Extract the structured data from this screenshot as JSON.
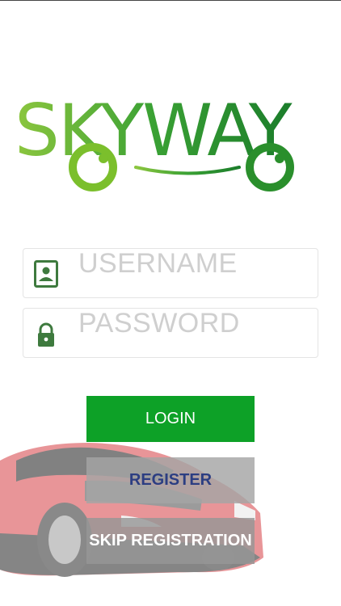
{
  "app": {
    "logo_text": "SKYWAY",
    "colors": {
      "light_green": "#8cc63f",
      "dark_green": "#1b7d2b",
      "mid_green": "#2e9a31"
    }
  },
  "form": {
    "username": {
      "placeholder": "USERNAME",
      "icon": "contact-card-icon"
    },
    "password": {
      "placeholder": "PASSWORD",
      "icon": "lock-icon"
    }
  },
  "buttons": {
    "login": "LOGIN",
    "register": "REGISTER",
    "skip": "SKIP REGISTRATION"
  },
  "colors": {
    "login_bg": "#0da127",
    "register_text": "#2c3e82",
    "icon_green": "#3e7a3e"
  }
}
